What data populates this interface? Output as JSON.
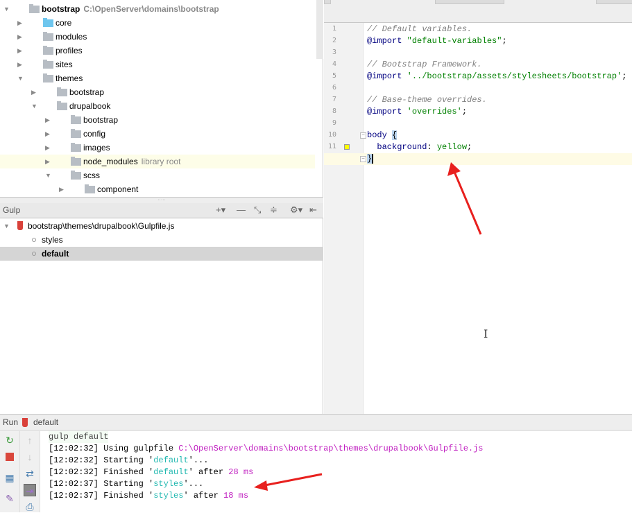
{
  "project_tree": {
    "items": [
      {
        "label": "bootstrap",
        "hint": "C:\\OpenServer\\domains\\bootstrap",
        "depth": 0,
        "expanded": true,
        "bold": true
      },
      {
        "label": "core",
        "depth": 1,
        "expanded": false,
        "blue": true
      },
      {
        "label": "modules",
        "depth": 1,
        "expanded": false
      },
      {
        "label": "profiles",
        "depth": 1,
        "expanded": false
      },
      {
        "label": "sites",
        "depth": 1,
        "expanded": false
      },
      {
        "label": "themes",
        "depth": 1,
        "expanded": true
      },
      {
        "label": "bootstrap",
        "depth": 2,
        "expanded": false
      },
      {
        "label": "drupalbook",
        "depth": 2,
        "expanded": true
      },
      {
        "label": "bootstrap",
        "depth": 3,
        "expanded": false
      },
      {
        "label": "config",
        "depth": 3,
        "expanded": false
      },
      {
        "label": "images",
        "depth": 3,
        "expanded": false
      },
      {
        "label": "node_modules",
        "hint": "library root",
        "depth": 3,
        "expanded": false,
        "highlight": true
      },
      {
        "label": "scss",
        "depth": 3,
        "expanded": true
      },
      {
        "label": "component",
        "depth": 4,
        "expanded": false
      }
    ]
  },
  "gulp": {
    "title": "Gulp",
    "gulpfile": "bootstrap\\themes\\drupalbook\\Gulpfile.js",
    "tasks": [
      {
        "label": "styles",
        "selected": false
      },
      {
        "label": "default",
        "selected": true
      }
    ]
  },
  "editor": {
    "lines": [
      [
        {
          "c": "comment",
          "t": "// Default variables."
        }
      ],
      [
        {
          "c": "kw",
          "t": "@import"
        },
        {
          "c": "punct",
          "t": " "
        },
        {
          "c": "str",
          "t": "\"default-variables\""
        },
        {
          "c": "punct",
          "t": ";"
        }
      ],
      [],
      [
        {
          "c": "comment",
          "t": "// Bootstrap Framework."
        }
      ],
      [
        {
          "c": "kw",
          "t": "@import"
        },
        {
          "c": "punct",
          "t": " "
        },
        {
          "c": "str",
          "t": "'../bootstrap/assets/stylesheets/bootstrap'"
        },
        {
          "c": "punct",
          "t": ";"
        }
      ],
      [],
      [
        {
          "c": "comment",
          "t": "// Base-theme overrides."
        }
      ],
      [
        {
          "c": "kw",
          "t": "@import"
        },
        {
          "c": "punct",
          "t": " "
        },
        {
          "c": "str",
          "t": "'overrides'"
        },
        {
          "c": "punct",
          "t": ";"
        }
      ],
      [],
      [
        {
          "c": "sel",
          "t": "body"
        },
        {
          "c": "punct",
          "t": " "
        },
        {
          "c": "brace",
          "t": "{"
        }
      ],
      [
        {
          "c": "punct",
          "t": "  "
        },
        {
          "c": "kw",
          "t": "background"
        },
        {
          "c": "punct",
          "t": ": "
        },
        {
          "c": "val",
          "t": "yellow"
        },
        {
          "c": "punct",
          "t": ";"
        }
      ],
      [
        {
          "c": "brace",
          "t": "}"
        }
      ]
    ],
    "color_marker_line": 11,
    "color_marker": "#ffff00",
    "current_line": 12
  },
  "run": {
    "label": "Run",
    "config": "default",
    "console": [
      [
        {
          "c": "cmd",
          "t": "gulp default"
        }
      ],
      [
        {
          "c": "",
          "t": "[12:02:32] Using gulpfile "
        },
        {
          "c": "path",
          "t": "C:\\OpenServer\\domains\\bootstrap\\themes\\drupalbook\\Gulpfile.js"
        }
      ],
      [
        {
          "c": "",
          "t": "[12:02:32] Starting '"
        },
        {
          "c": "task",
          "t": "default"
        },
        {
          "c": "",
          "t": "'..."
        }
      ],
      [
        {
          "c": "",
          "t": "[12:02:32] Finished '"
        },
        {
          "c": "task",
          "t": "default"
        },
        {
          "c": "",
          "t": "' after "
        },
        {
          "c": "num",
          "t": "28 ms"
        }
      ],
      [
        {
          "c": "",
          "t": "[12:02:37] Starting '"
        },
        {
          "c": "task",
          "t": "styles"
        },
        {
          "c": "",
          "t": "'..."
        }
      ],
      [
        {
          "c": "",
          "t": "[12:02:37] Finished '"
        },
        {
          "c": "task",
          "t": "styles"
        },
        {
          "c": "",
          "t": "' after "
        },
        {
          "c": "num",
          "t": "18 ms"
        }
      ]
    ]
  },
  "annotation_color": "#e8201e"
}
